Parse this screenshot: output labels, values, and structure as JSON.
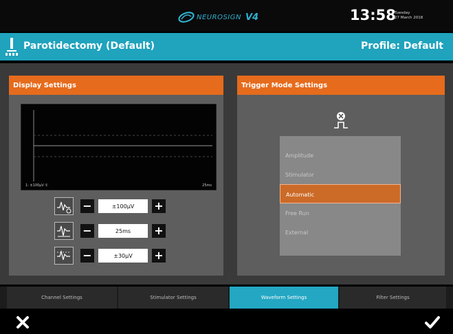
{
  "topbar": {
    "brand_name": "NEUROSIGN",
    "brand_version": "V4",
    "time": "13:58",
    "date_line1": "Tuesday",
    "date_line2": "27 March 2018"
  },
  "header": {
    "procedure": "Parotidectomy (Default)",
    "profile": "Profile: Default"
  },
  "display_settings": {
    "title": "Display Settings",
    "scope_left_label": "1: ±100μV  ①",
    "scope_right_label": "25ms",
    "controls": [
      {
        "value": "±100μV",
        "icon": "amplitude-scale-icon"
      },
      {
        "value": "25ms",
        "icon": "timebase-icon"
      },
      {
        "value": "±30μV",
        "icon": "trigger-level-icon"
      }
    ],
    "minus_label": "−",
    "plus_label": "+"
  },
  "trigger_settings": {
    "title": "Trigger Mode Settings",
    "icon": "trigger-mode-icon",
    "options": [
      "Amplitude",
      "Stimulator",
      "Automatic",
      "Free Run",
      "External"
    ],
    "selected": "Automatic"
  },
  "tabs": [
    {
      "label": "Channel Settings",
      "active": false
    },
    {
      "label": "Stimulator Settings",
      "active": false
    },
    {
      "label": "Waveform Settings",
      "active": true
    },
    {
      "label": "Filter Settings",
      "active": false
    }
  ],
  "colors": {
    "accent_cyan": "#20a3bd",
    "accent_orange": "#e66b1c",
    "panel_grey": "#5e5e5e"
  }
}
